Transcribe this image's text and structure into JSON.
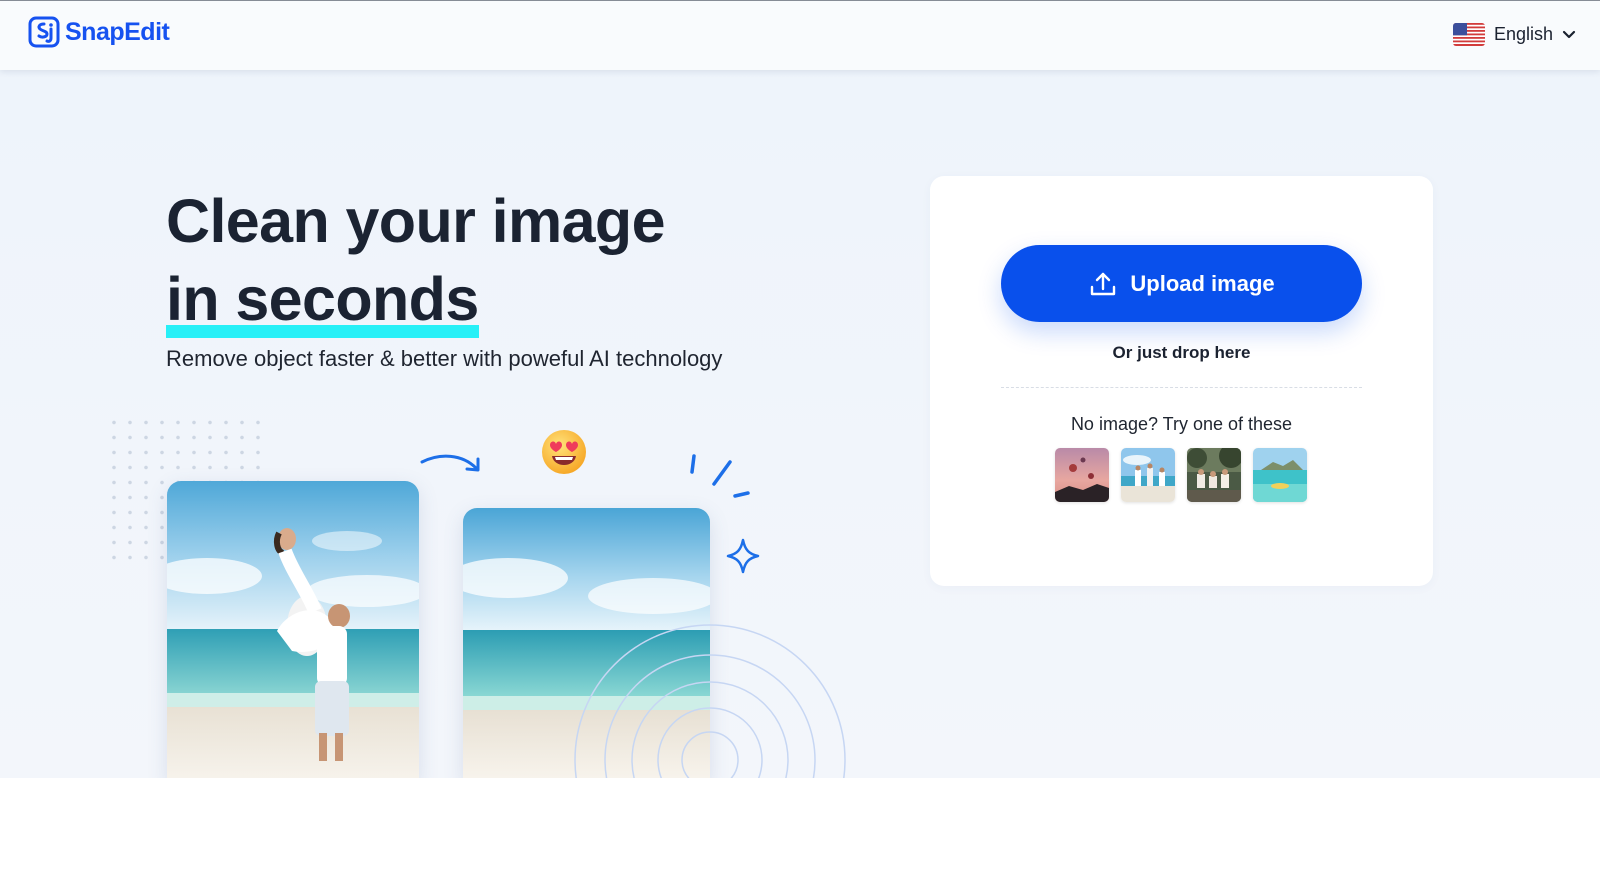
{
  "header": {
    "brand": "SnapEdit",
    "language": {
      "label": "English",
      "flag_icon": "us-flag-icon"
    }
  },
  "hero": {
    "title_line1": "Clean your image",
    "title_line2": "in seconds",
    "subtitle": "Remove object faster & better with poweful AI technology",
    "highlight_color": "#27f0f7"
  },
  "upload": {
    "button_label": "Upload image",
    "drop_hint": "Or just drop here",
    "samples_label": "No image? Try one of these",
    "samples": [
      {
        "name": "hot-air-balloons-sample"
      },
      {
        "name": "beach-group-sample"
      },
      {
        "name": "forest-group-sample"
      },
      {
        "name": "island-sea-sample"
      }
    ]
  },
  "colors": {
    "brand_blue": "#1652f0",
    "button_blue": "#0950ec",
    "text_dark": "#1b2332"
  }
}
